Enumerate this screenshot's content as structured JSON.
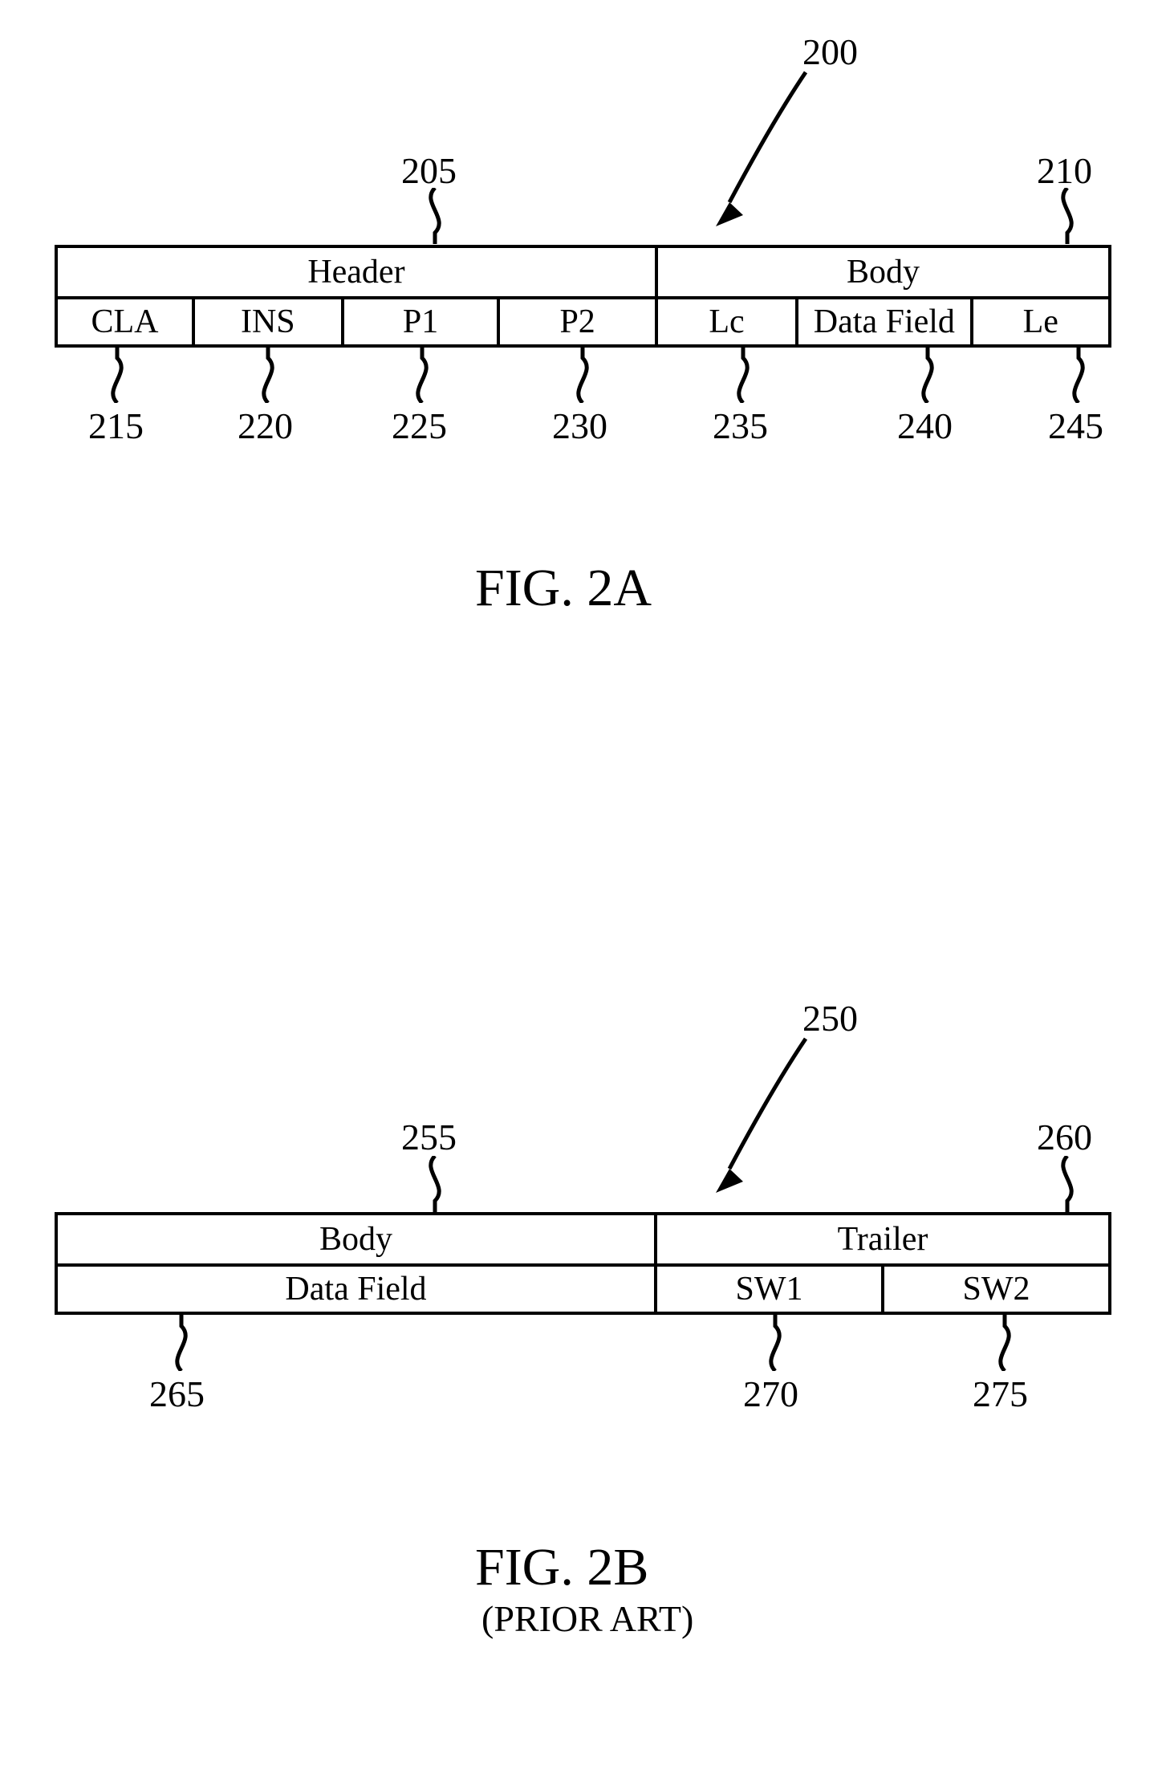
{
  "figA": {
    "pointer_ref": "200",
    "header_ref": "205",
    "body_ref": "210",
    "header_label": "Header",
    "body_label": "Body",
    "cols": {
      "cla": {
        "label": "CLA",
        "ref": "215"
      },
      "ins": {
        "label": "INS",
        "ref": "220"
      },
      "p1": {
        "label": "P1",
        "ref": "225"
      },
      "p2": {
        "label": "P2",
        "ref": "230"
      },
      "lc": {
        "label": "Lc",
        "ref": "235"
      },
      "data_field": {
        "label": "Data Field",
        "ref": "240"
      },
      "le": {
        "label": "Le",
        "ref": "245"
      }
    },
    "caption": "FIG.  2A"
  },
  "figB": {
    "pointer_ref": "250",
    "body_ref": "255",
    "trailer_ref": "260",
    "body_label": "Body",
    "trailer_label": "Trailer",
    "cols": {
      "data_field": {
        "label": "Data Field",
        "ref": "265"
      },
      "sw1": {
        "label": "SW1",
        "ref": "270"
      },
      "sw2": {
        "label": "SW2",
        "ref": "275"
      }
    },
    "caption": "FIG.  2B",
    "subcaption": "(PRIOR ART)"
  }
}
